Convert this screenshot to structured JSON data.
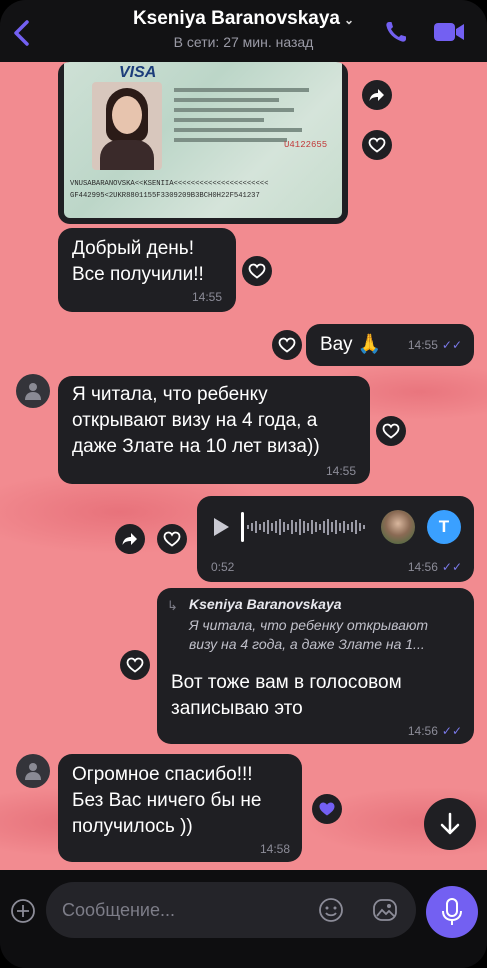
{
  "header": {
    "contact_name": "Kseniya Baranovskaya",
    "chevron": "⌄",
    "status": "В сети: 27 мин. назад"
  },
  "photo": {
    "visa_label": "VISA",
    "mrz_line1": "VNUSABARANOVSKA<<KSENIIA<<<<<<<<<<<<<<<<<<<<<<",
    "mrz_line2": "GF442995<2UKR8801155F3309209B3BCH0H22F541237",
    "id_digits": "U4122655"
  },
  "messages": [
    {
      "id": "m1",
      "direction": "incoming",
      "text": "Добрый день!\nВсе получили!!",
      "time": "14:55"
    },
    {
      "id": "m2",
      "direction": "outgoing",
      "text": "Вау 🙏",
      "time": "14:55"
    },
    {
      "id": "m3",
      "direction": "incoming",
      "text": "Я читала, что ребенку\nоткрывают визу на 4 года, а\nдаже Злате на 10 лет виза))",
      "time": "14:55"
    },
    {
      "id": "m4",
      "direction": "outgoing",
      "type": "voice",
      "duration": "0:52",
      "time": "14:56",
      "transcribe_label": "T"
    },
    {
      "id": "m5",
      "direction": "outgoing",
      "reply_to_name": "Kseniya Baranovskaya",
      "reply_to_text": "Я читала, что ребенку открывают\nвизу на 4 года, а даже Злате на 1...",
      "text": "Вот тоже вам в голосовом\nзаписываю это",
      "time": "14:56"
    },
    {
      "id": "m6",
      "direction": "incoming",
      "text": "Огромное спасибо!!!\nБез Вас ничего бы не\nполучилось ))",
      "time": "14:58"
    }
  ],
  "composer": {
    "placeholder": "Сообщение..."
  },
  "colors": {
    "accent": "#7360f2",
    "bubble": "#1f1f23",
    "chat_background": "#f28b90"
  },
  "icons": [
    "back-arrow-icon",
    "phone-icon",
    "video-icon",
    "forward-icon",
    "heart-icon",
    "play-icon",
    "scroll-down-icon",
    "plus-icon",
    "sticker-icon",
    "gallery-icon",
    "mic-icon"
  ]
}
